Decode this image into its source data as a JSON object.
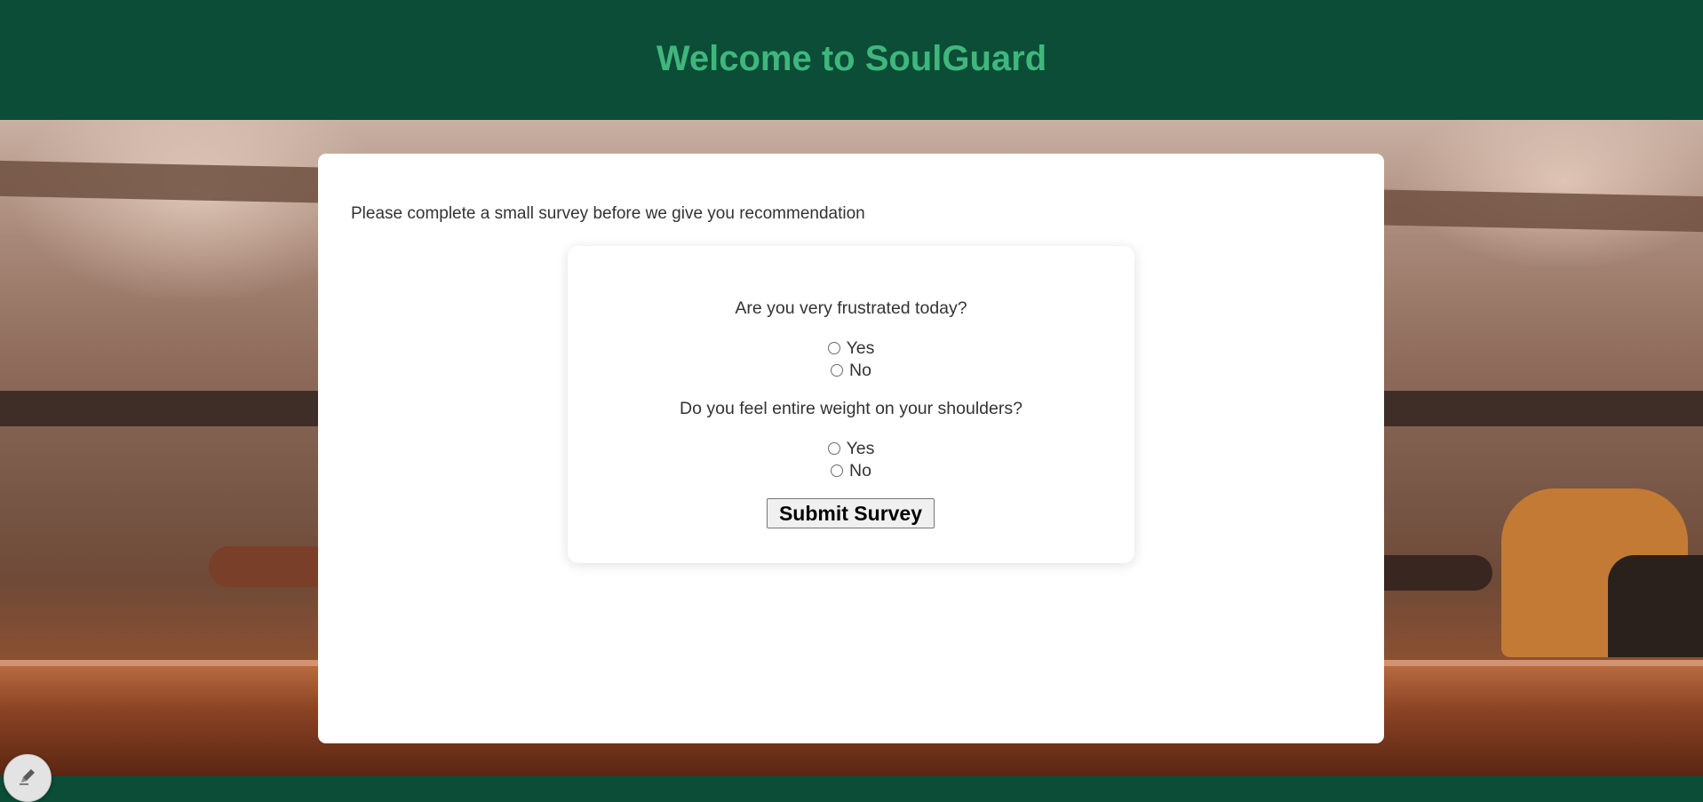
{
  "header": {
    "title": "Welcome to SoulGuard"
  },
  "content": {
    "intro_text": "Please complete a small survey before we give you recommendation"
  },
  "survey": {
    "questions": [
      {
        "text": "Are you very frustrated today?",
        "options": [
          {
            "label": "Yes",
            "selected": false
          },
          {
            "label": "No",
            "selected": false
          }
        ]
      },
      {
        "text": "Do you feel entire weight on your shoulders?",
        "options": [
          {
            "label": "Yes",
            "selected": false
          },
          {
            "label": "No",
            "selected": false
          }
        ]
      }
    ],
    "submit_label": "Submit Survey"
  },
  "floating_button": {
    "icon": "pen-icon"
  },
  "colors": {
    "header_bg": "#0b4d37",
    "title": "#3fb77c",
    "card_bg": "#ffffff",
    "text": "#333333"
  }
}
